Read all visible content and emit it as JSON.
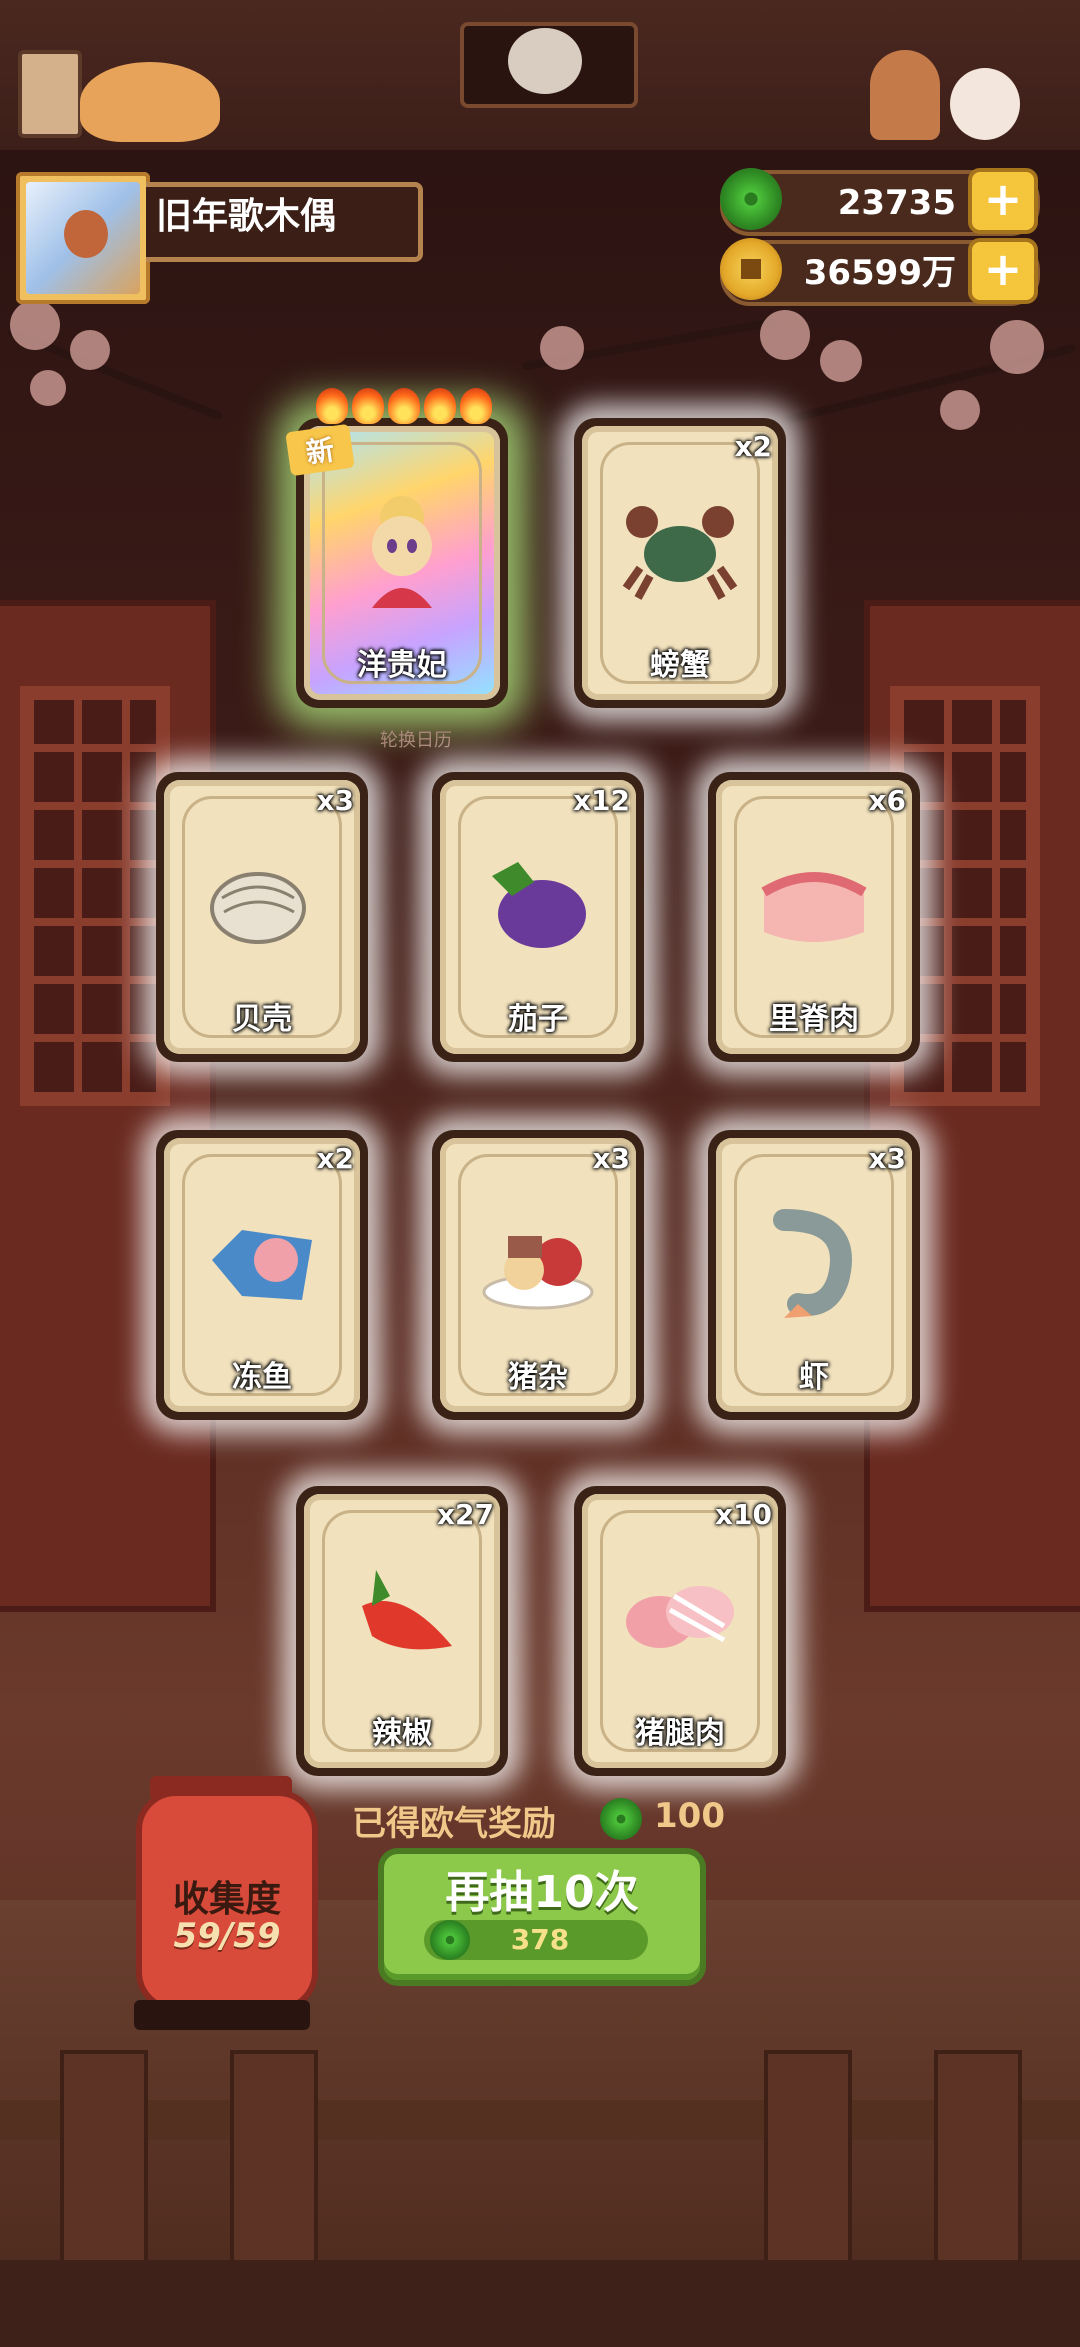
{
  "player": {
    "name": "旧年歌木偶"
  },
  "currencies": {
    "jade": "23735",
    "coins": "36599万"
  },
  "cards": [
    {
      "name": "洋贵妃",
      "count": "",
      "tag": "新",
      "special": true
    },
    {
      "name": "螃蟹",
      "count": "x2"
    },
    {
      "name": "贝壳",
      "count": "x3"
    },
    {
      "name": "茄子",
      "count": "x12"
    },
    {
      "name": "里脊肉",
      "count": "x6"
    },
    {
      "name": "冻鱼",
      "count": "x2"
    },
    {
      "name": "猪杂",
      "count": "x3"
    },
    {
      "name": "虾",
      "count": "x3"
    },
    {
      "name": "辣椒",
      "count": "x27"
    },
    {
      "name": "猪腿肉",
      "count": "x10"
    }
  ],
  "under_card_text": "轮换日历",
  "collection": {
    "title": "收集度",
    "value": "59/59"
  },
  "reward": {
    "label": "已得欧气奖励",
    "value": "100"
  },
  "draw_button": {
    "label": "再抽10次",
    "cost": "378"
  }
}
